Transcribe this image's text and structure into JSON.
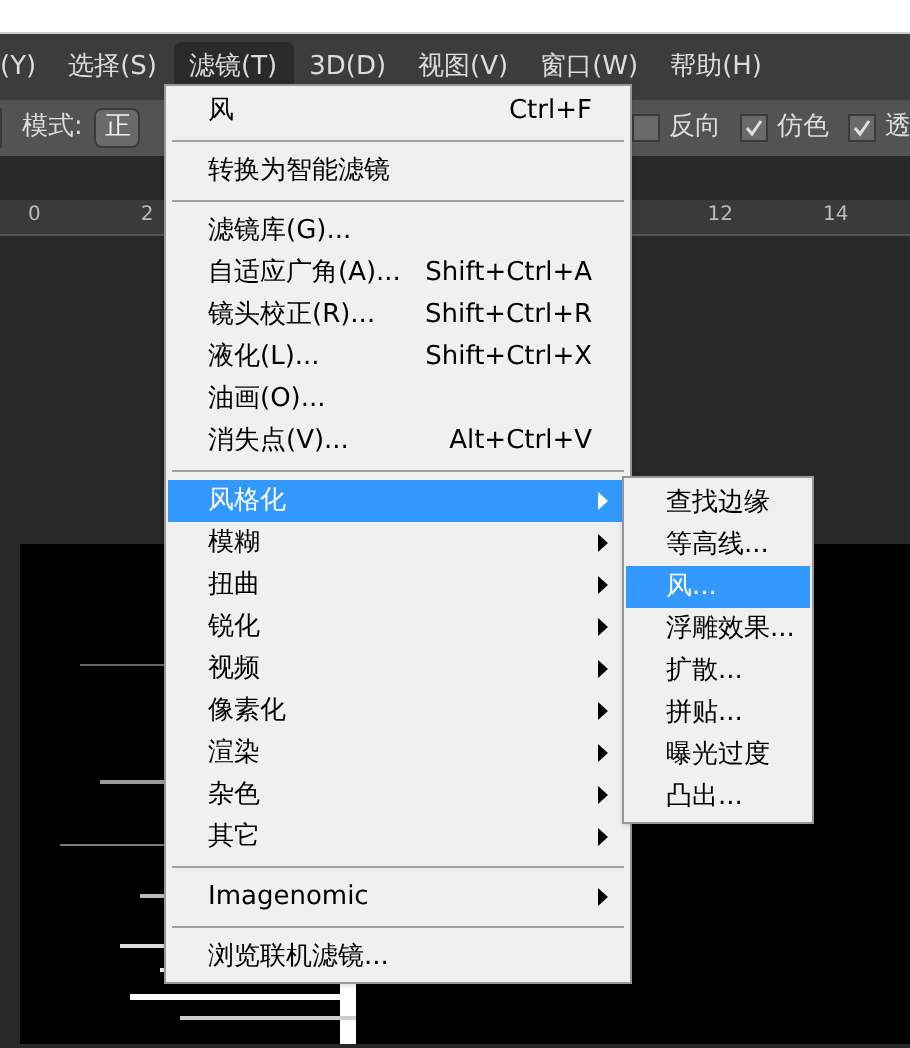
{
  "menu_bar": [
    {
      "label": "(Y)",
      "selected": false
    },
    {
      "label": "选择(S)",
      "selected": false
    },
    {
      "label": "滤镜(T)",
      "selected": true
    },
    {
      "label": "3D(D)",
      "selected": false
    },
    {
      "label": "视图(V)",
      "selected": false
    },
    {
      "label": "窗口(W)",
      "selected": false
    },
    {
      "label": "帮助(H)",
      "selected": false
    }
  ],
  "options_bar": {
    "mode_label": "模式:",
    "mode_value": "正",
    "checkboxes": [
      {
        "label": "反向",
        "checked": false
      },
      {
        "label": "仿色",
        "checked": true
      },
      {
        "label": "透",
        "checked": true
      }
    ]
  },
  "ruler": {
    "left_labels": [
      "0",
      "2"
    ],
    "right_labels": [
      "12",
      "14"
    ]
  },
  "filter_menu": {
    "sections": [
      [
        {
          "label": "风",
          "shortcut": "Ctrl+F",
          "submenu": false,
          "selected": false
        }
      ],
      [
        {
          "label": "转换为智能滤镜",
          "submenu": false,
          "selected": false
        }
      ],
      [
        {
          "label": "滤镜库(G)...",
          "submenu": false,
          "selected": false
        },
        {
          "label": "自适应广角(A)...",
          "shortcut": "Shift+Ctrl+A",
          "submenu": false,
          "selected": false
        },
        {
          "label": "镜头校正(R)...",
          "shortcut": "Shift+Ctrl+R",
          "submenu": false,
          "selected": false
        },
        {
          "label": "液化(L)...",
          "shortcut": "Shift+Ctrl+X",
          "submenu": false,
          "selected": false
        },
        {
          "label": "油画(O)...",
          "submenu": false,
          "selected": false
        },
        {
          "label": "消失点(V)...",
          "shortcut": "Alt+Ctrl+V",
          "submenu": false,
          "selected": false
        }
      ],
      [
        {
          "label": "风格化",
          "submenu": true,
          "selected": true
        },
        {
          "label": "模糊",
          "submenu": true,
          "selected": false
        },
        {
          "label": "扭曲",
          "submenu": true,
          "selected": false
        },
        {
          "label": "锐化",
          "submenu": true,
          "selected": false
        },
        {
          "label": "视频",
          "submenu": true,
          "selected": false
        },
        {
          "label": "像素化",
          "submenu": true,
          "selected": false
        },
        {
          "label": "渲染",
          "submenu": true,
          "selected": false
        },
        {
          "label": "杂色",
          "submenu": true,
          "selected": false
        },
        {
          "label": "其它",
          "submenu": true,
          "selected": false
        }
      ],
      [
        {
          "label": "Imagenomic",
          "submenu": true,
          "selected": false
        }
      ],
      [
        {
          "label": "浏览联机滤镜...",
          "submenu": false,
          "selected": false
        }
      ]
    ]
  },
  "stylize_submenu": [
    {
      "label": "查找边缘",
      "selected": false
    },
    {
      "label": "等高线...",
      "selected": false
    },
    {
      "label": "风...",
      "selected": true
    },
    {
      "label": "浮雕效果...",
      "selected": false
    },
    {
      "label": "扩散...",
      "selected": false
    },
    {
      "label": "拼贴...",
      "selected": false
    },
    {
      "label": "曝光过度",
      "selected": false
    },
    {
      "label": "凸出...",
      "selected": false
    }
  ]
}
